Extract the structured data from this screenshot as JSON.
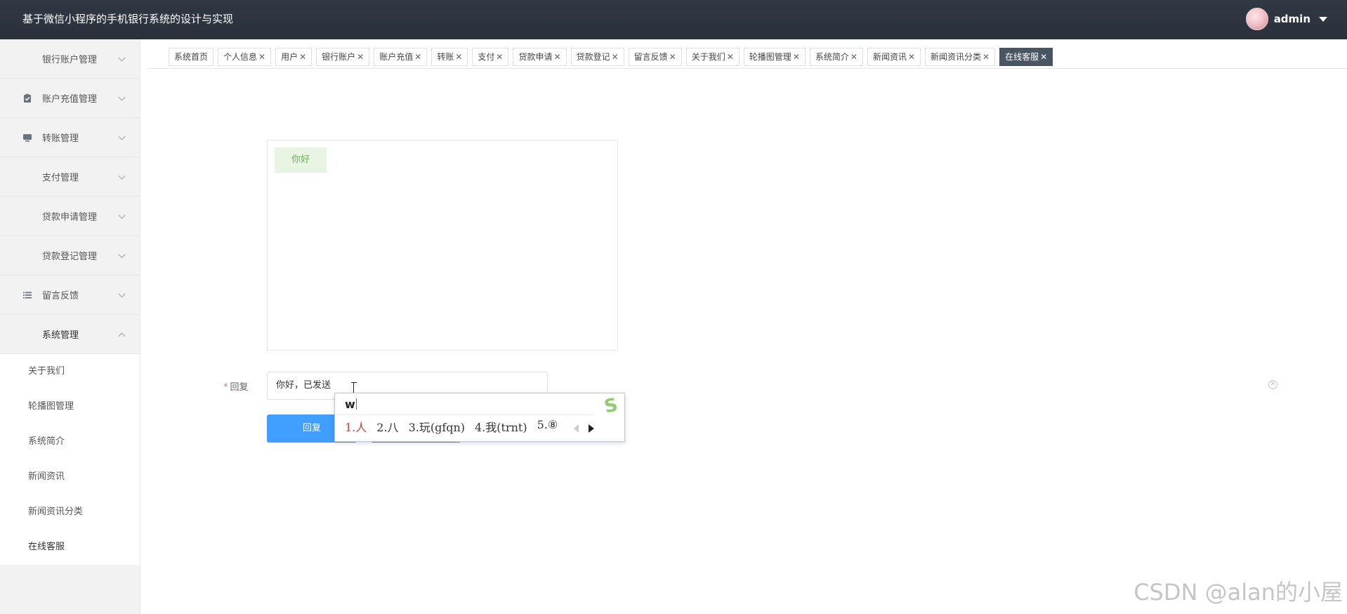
{
  "app": {
    "title": "基于微信小程序的手机银行系统的设计与实现"
  },
  "user": {
    "name": "admin"
  },
  "sidebar": {
    "items": [
      {
        "label": "银行账户管理",
        "icon": "grid-icon",
        "expanded": false
      },
      {
        "label": "账户充值管理",
        "icon": "clipboard-check-icon",
        "expanded": false
      },
      {
        "label": "转账管理",
        "icon": "monitor-icon",
        "expanded": false
      },
      {
        "label": "支付管理",
        "icon": "grid-icon",
        "expanded": false
      },
      {
        "label": "贷款申请管理",
        "icon": "grid-icon",
        "expanded": false
      },
      {
        "label": "贷款登记管理",
        "icon": "grid-icon",
        "expanded": false
      },
      {
        "label": "留言反馈",
        "icon": "list-icon",
        "expanded": false
      },
      {
        "label": "系统管理",
        "icon": "grid-icon",
        "expanded": true
      }
    ],
    "subitems": [
      "关于我们",
      "轮播图管理",
      "系统简介",
      "新闻资讯",
      "新闻资讯分类",
      "在线客服"
    ],
    "active_subitem": "在线客服"
  },
  "tabs": [
    {
      "label": "系统首页",
      "closable": false
    },
    {
      "label": "个人信息",
      "closable": true
    },
    {
      "label": "用户",
      "closable": true
    },
    {
      "label": "银行账户",
      "closable": true
    },
    {
      "label": "账户充值",
      "closable": true
    },
    {
      "label": "转账",
      "closable": true
    },
    {
      "label": "支付",
      "closable": true
    },
    {
      "label": "贷款申请",
      "closable": true
    },
    {
      "label": "贷款登记",
      "closable": true
    },
    {
      "label": "留言反馈",
      "closable": true
    },
    {
      "label": "关于我们",
      "closable": true
    },
    {
      "label": "轮播图管理",
      "closable": true
    },
    {
      "label": "系统简介",
      "closable": true
    },
    {
      "label": "新闻资讯",
      "closable": true
    },
    {
      "label": "新闻资讯分类",
      "closable": true
    },
    {
      "label": "在线客服",
      "closable": true,
      "active": true
    }
  ],
  "chat": {
    "messages": [
      "你好"
    ]
  },
  "form": {
    "reply_label": "回复",
    "reply_value": "你好，已发送",
    "submit_label": "回复"
  },
  "ime": {
    "pinyin": "w",
    "candidates": [
      "1.人",
      "2.八",
      "3.玩(gfqn)",
      "4.我(trnt)",
      "5.⑧"
    ],
    "logo": "S"
  },
  "watermark": "CSDN @alan的小屋",
  "colors": {
    "topbar": "#2f3640",
    "primary": "#409eff",
    "active_tab": "#4a5563",
    "bubble_bg": "#e8f5e3",
    "bubble_text": "#67b34d"
  }
}
